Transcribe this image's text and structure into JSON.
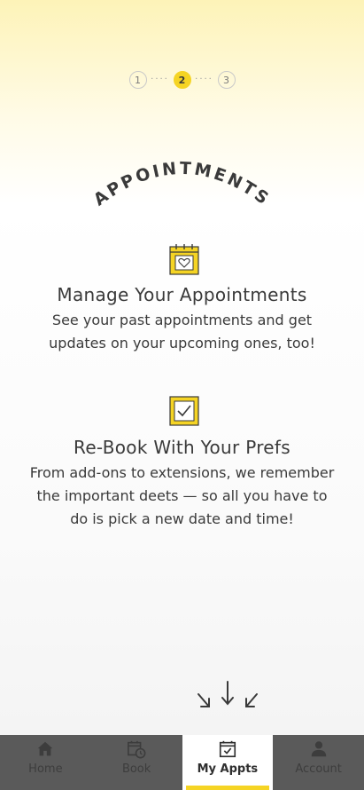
{
  "stepper": {
    "steps": [
      "1",
      "2",
      "3"
    ],
    "active_step": 2
  },
  "section_title": "APPOINTMENTS",
  "features": [
    {
      "icon": "calendar-heart-icon",
      "title": "Manage Your Appointments",
      "body": "See your past appointments and get updates on your upcoming ones, too!"
    },
    {
      "icon": "checkbox-icon",
      "title": "Re-Book With Your Prefs",
      "body": "From add-ons to extensions, we remember the important deets — so all you have to do is pick a new date and time!"
    }
  ],
  "scroll_hint_icon": "down-arrows-icon",
  "tabbar": {
    "tabs": [
      {
        "label": "Home",
        "icon": "home-icon",
        "active": false
      },
      {
        "label": "Book",
        "icon": "calendar-clock-icon",
        "active": false
      },
      {
        "label": "My Appts",
        "icon": "calendar-check-icon",
        "active": true
      },
      {
        "label": "Account",
        "icon": "person-icon",
        "active": false
      }
    ]
  },
  "colors": {
    "accent": "#f5d424",
    "text": "#3a3a3a",
    "tabbar_bg": "#5a5a5a"
  }
}
